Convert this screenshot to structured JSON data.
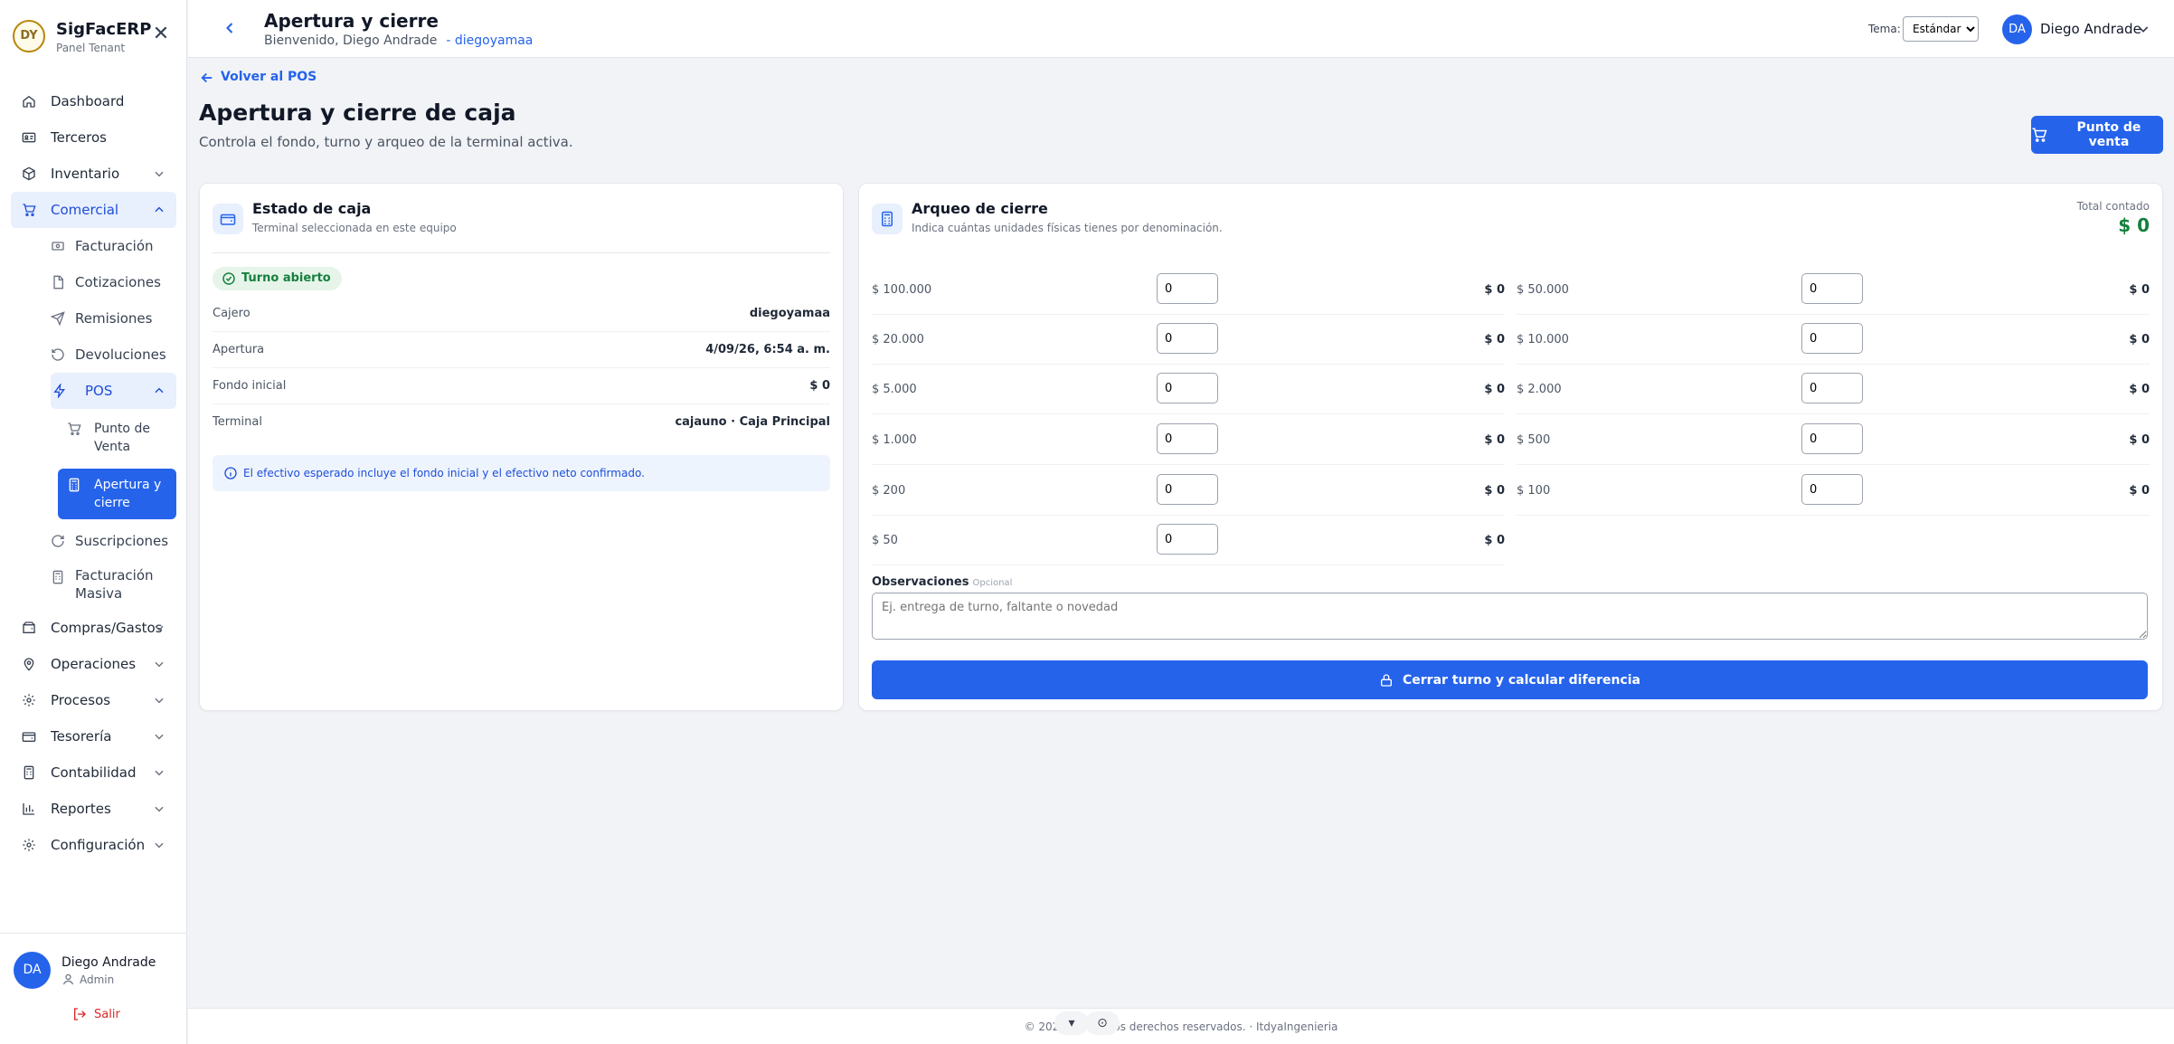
{
  "brand": {
    "title": "SigFacERP",
    "subtitle": "Panel Tenant",
    "logo_text": "DY"
  },
  "nav": {
    "dashboard": "Dashboard",
    "terceros": "Terceros",
    "inventario": "Inventario",
    "comercial": "Comercial",
    "facturacion": "Facturación",
    "cotizaciones": "Cotizaciones",
    "remisiones": "Remisiones",
    "devoluciones": "Devoluciones",
    "pos": "POS",
    "punto_venta": "Punto de Venta",
    "apertura_cierre": "Apertura y cierre",
    "suscripciones": "Suscripciones",
    "facturacion_masiva": "Facturación Masiva",
    "compras_gastos": "Compras/Gastos",
    "operaciones": "Operaciones",
    "procesos": "Procesos",
    "tesoreria": "Tesorería",
    "contabilidad": "Contabilidad",
    "reportes": "Reportes",
    "configuracion": "Configuración"
  },
  "sidebar_user": {
    "initials": "DA",
    "name": "Diego Andrade",
    "role": "Admin",
    "logout": "Salir"
  },
  "header": {
    "title": "Apertura y cierre",
    "welcome": "Bienvenido, Diego Andrade",
    "username": "- diegoyamaa",
    "tema_label": "Tema:",
    "tema_value": "Estándar",
    "user_initials": "DA",
    "user_name": "Diego Andrade"
  },
  "page": {
    "back_link": "Volver al POS",
    "title": "Apertura y cierre de caja",
    "description": "Controla el fondo, turno y arqueo de la terminal activa.",
    "pos_button": "Punto de venta"
  },
  "estado": {
    "title": "Estado de caja",
    "subtitle": "Terminal seleccionada en este equipo",
    "badge": "Turno abierto",
    "rows": [
      {
        "label": "Cajero",
        "value": "diegoyamaa"
      },
      {
        "label": "Apertura",
        "value": "4/09/26, 6:54 a. m."
      },
      {
        "label": "Fondo inicial",
        "value": "$ 0"
      },
      {
        "label": "Terminal",
        "value": "cajauno · Caja Principal"
      }
    ],
    "info": "El efectivo esperado incluye el fondo inicial y el efectivo neto confirmado."
  },
  "arqueo": {
    "title": "Arqueo de cierre",
    "subtitle": "Indica cuántas unidades físicas tienes por denominación.",
    "total_label": "Total contado",
    "total_value": "$ 0",
    "denominations": [
      {
        "label": "$ 100.000",
        "qty": "0",
        "subtotal": "$ 0"
      },
      {
        "label": "$ 50.000",
        "qty": "0",
        "subtotal": "$ 0"
      },
      {
        "label": "$ 20.000",
        "qty": "0",
        "subtotal": "$ 0"
      },
      {
        "label": "$ 10.000",
        "qty": "0",
        "subtotal": "$ 0"
      },
      {
        "label": "$ 5.000",
        "qty": "0",
        "subtotal": "$ 0"
      },
      {
        "label": "$ 2.000",
        "qty": "0",
        "subtotal": "$ 0"
      },
      {
        "label": "$ 1.000",
        "qty": "0",
        "subtotal": "$ 0"
      },
      {
        "label": "$ 500",
        "qty": "0",
        "subtotal": "$ 0"
      },
      {
        "label": "$ 200",
        "qty": "0",
        "subtotal": "$ 0"
      },
      {
        "label": "$ 100",
        "qty": "0",
        "subtotal": "$ 0"
      },
      {
        "label": "$ 50",
        "qty": "0",
        "subtotal": "$ 0"
      }
    ],
    "obs_label": "Observaciones",
    "obs_optional": "Opcional",
    "obs_placeholder": "Ej. entrega de turno, faltante o novedad",
    "close_button": "Cerrar turno y calcular diferencia"
  },
  "footer": {
    "text": "© 2026 · Todos los derechos reservados. · ItdyaIngenieria"
  },
  "colors": {
    "accent": "#2563eb",
    "success": "#15803d"
  }
}
